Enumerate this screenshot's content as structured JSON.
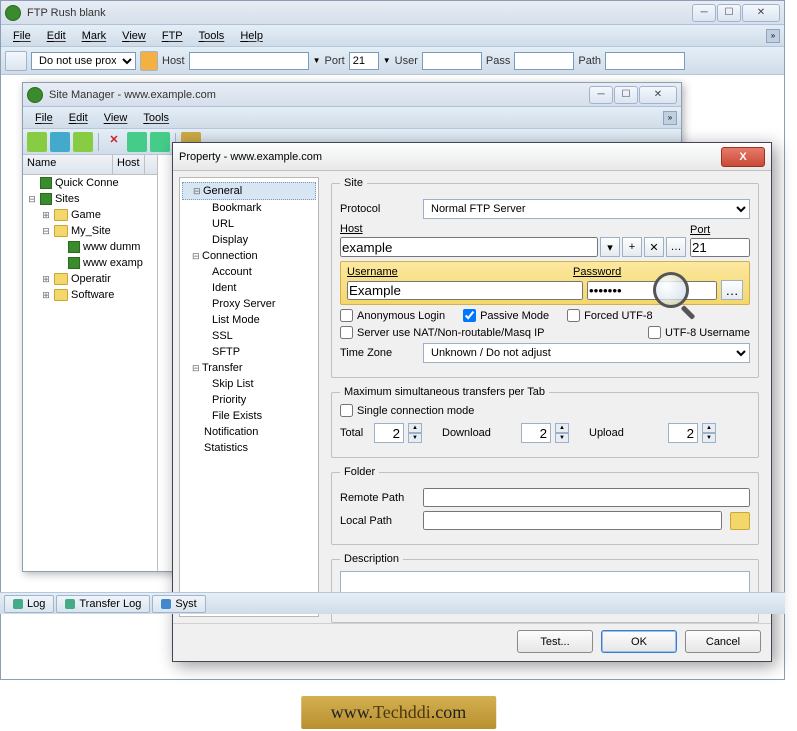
{
  "main": {
    "title": "FTP Rush   blank",
    "menu": [
      "File",
      "Edit",
      "Mark",
      "View",
      "FTP",
      "Tools",
      "Help"
    ],
    "toolbar": {
      "proxy": "Do not use proxy",
      "host_label": "Host",
      "host": "",
      "port_label": "Port",
      "port": "21",
      "user_label": "User",
      "user": "",
      "pass_label": "Pass",
      "pass": "",
      "path_label": "Path",
      "path": ""
    }
  },
  "sm": {
    "title": "Site Manager  - www.example.com",
    "menu": [
      "File",
      "Edit",
      "View",
      "Tools"
    ],
    "tree": {
      "col_name": "Name",
      "col_host": "Host",
      "quick": "Quick Conne",
      "sites": "Sites",
      "game": "Game",
      "mysites": "My_Site",
      "dummy": "www dumm",
      "example": "www examp",
      "operatir": "Operatir",
      "software": "Software"
    }
  },
  "prop": {
    "title": "Property - www.example.com",
    "nav": {
      "general": "General",
      "bookmark": "Bookmark",
      "url": "URL",
      "display": "Display",
      "connection": "Connection",
      "account": "Account",
      "ident": "Ident",
      "proxyserver": "Proxy Server",
      "listmode": "List Mode",
      "ssl": "SSL",
      "sftp": "SFTP",
      "transfer": "Transfer",
      "skiplist": "Skip List",
      "priority": "Priority",
      "fileexists": "File Exists",
      "notification": "Notification",
      "statistics": "Statistics"
    },
    "form": {
      "site_legend": "Site",
      "protocol_label": "Protocol",
      "protocol": "Normal FTP Server",
      "host_label": "Host",
      "host": "example",
      "port_label": "Port",
      "port": "21",
      "username_label": "Username",
      "username": "Example",
      "password_label": "Password",
      "password": "*******",
      "anon": "Anonymous Login",
      "passive": "Passive Mode",
      "utf8": "Forced UTF-8",
      "nat": "Server use NAT/Non-routable/Masq IP",
      "utf8user": "UTF-8 Username",
      "tz_label": "Time Zone",
      "tz": "Unknown / Do not adjust",
      "max_legend": "Maximum simultaneous transfers per Tab",
      "single": "Single connection mode",
      "total_label": "Total",
      "total": "2",
      "download_label": "Download",
      "download": "2",
      "upload_label": "Upload",
      "upload": "2",
      "folder_legend": "Folder",
      "remote_label": "Remote Path",
      "remote": "",
      "local_label": "Local Path",
      "local": "",
      "desc_legend": "Description",
      "desc": ""
    },
    "buttons": {
      "test": "Test...",
      "ok": "OK",
      "cancel": "Cancel"
    }
  },
  "tabs": {
    "log": "Log",
    "transfer": "Transfer Log",
    "syst": "Syst"
  },
  "watermark": {
    "prefix": "www.",
    "mid": "Techddi",
    "suffix": ".com"
  }
}
